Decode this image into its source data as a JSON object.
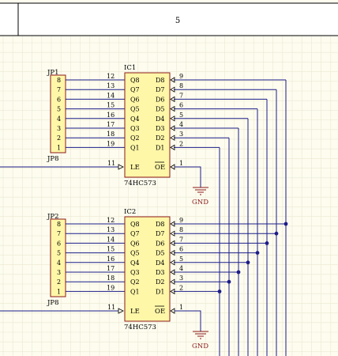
{
  "title_block": {
    "value": "5"
  },
  "components": {
    "ic1": {
      "ref": "IC1",
      "part": "74HC573"
    },
    "ic2": {
      "ref": "IC2",
      "part": "74HC573"
    },
    "jp1": {
      "ref": "JP1",
      "part": "JP8"
    },
    "jp2": {
      "ref": "JP2",
      "part": "JP8"
    }
  },
  "header_pins": [
    "8",
    "7",
    "6",
    "5",
    "4",
    "3",
    "2",
    "1"
  ],
  "ic_q_pin_numbers": [
    "12",
    "13",
    "14",
    "15",
    "16",
    "17",
    "18",
    "19"
  ],
  "ic_q_labels": [
    "Q8",
    "Q7",
    "Q6",
    "Q5",
    "Q4",
    "Q3",
    "Q2",
    "Q1"
  ],
  "ic_d_labels": [
    "D8",
    "D7",
    "D6",
    "D5",
    "D4",
    "D3",
    "D2",
    "D1"
  ],
  "ic_d_pin_numbers": [
    "9",
    "8",
    "7",
    "6",
    "5",
    "4",
    "3",
    "2"
  ],
  "ic_control": {
    "le_label": "LE",
    "le_pin": "11",
    "oe_label": "OE",
    "oe_pin": "1"
  },
  "ground_label": "GND",
  "colors": {
    "background": "#fdfcef",
    "grid": "#ece8d2",
    "wire": "#1c1c8a",
    "junction": "#1c1c8a",
    "component_fill": "#fff7a8",
    "component_outline": "#8b1a1a",
    "pin": "#000000",
    "ground_symbol": "#8b1a1a",
    "ground_label": "#8b1a1a",
    "text": "#000000"
  }
}
